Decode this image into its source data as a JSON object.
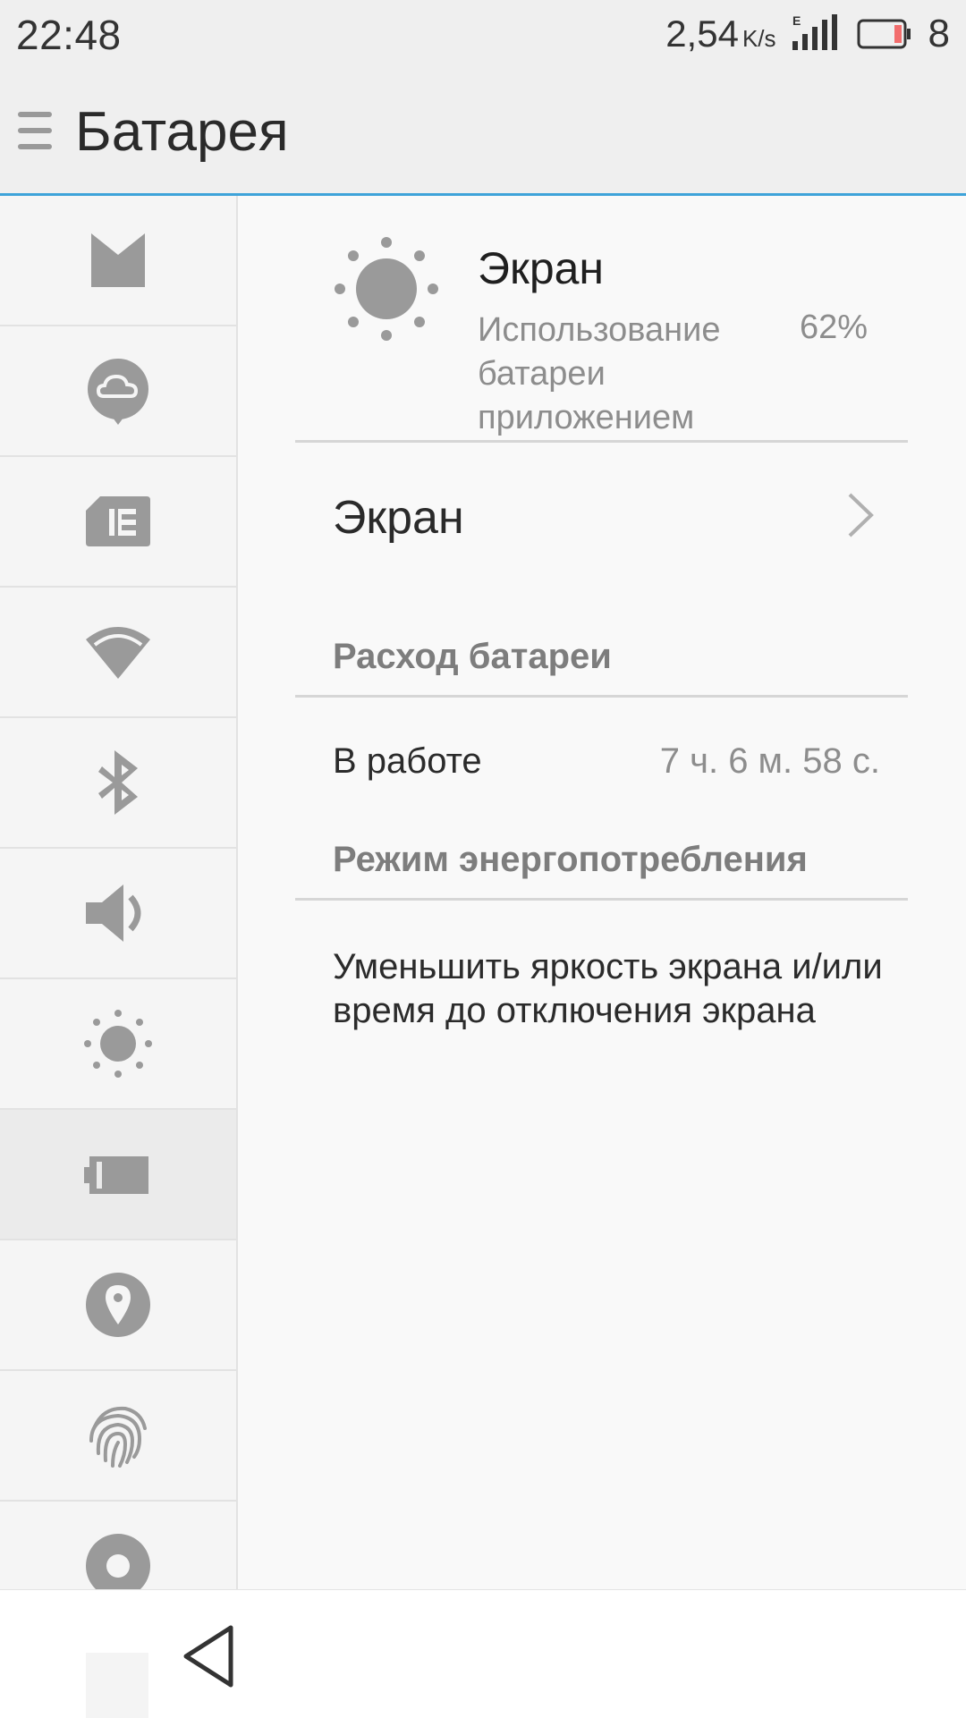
{
  "status_bar": {
    "time": "22:48",
    "net_speed": "2,54",
    "net_unit": "K/s",
    "network_type": "E",
    "battery_text": "8",
    "battery_color": "#f26d6d"
  },
  "header": {
    "title": "Батарея"
  },
  "sidebar": {
    "items": [
      {
        "icon": "phone-icon"
      },
      {
        "icon": "cloud-icon"
      },
      {
        "icon": "sim-card-icon"
      },
      {
        "icon": "wifi-icon"
      },
      {
        "icon": "bluetooth-icon"
      },
      {
        "icon": "volume-icon"
      },
      {
        "icon": "brightness-icon"
      },
      {
        "icon": "battery-icon",
        "selected": true
      },
      {
        "icon": "location-icon"
      },
      {
        "icon": "fingerprint-icon"
      },
      {
        "icon": "record-icon"
      }
    ]
  },
  "app": {
    "name": "Экран",
    "usage_label": "Использование батареи приложением",
    "usage_value": "62%",
    "icon": "brightness-icon"
  },
  "nav_row": {
    "label": "Экран"
  },
  "battery_consumption": {
    "title": "Расход батареи",
    "rows": [
      {
        "label": "В работе",
        "value": "7 ч. 6 м. 58 с."
      }
    ]
  },
  "power_mode": {
    "title": "Режим энергопотребления",
    "tip": "Уменьшить яркость экрана и/или время до отключения экрана"
  },
  "accent_color": "#3ea3d9"
}
